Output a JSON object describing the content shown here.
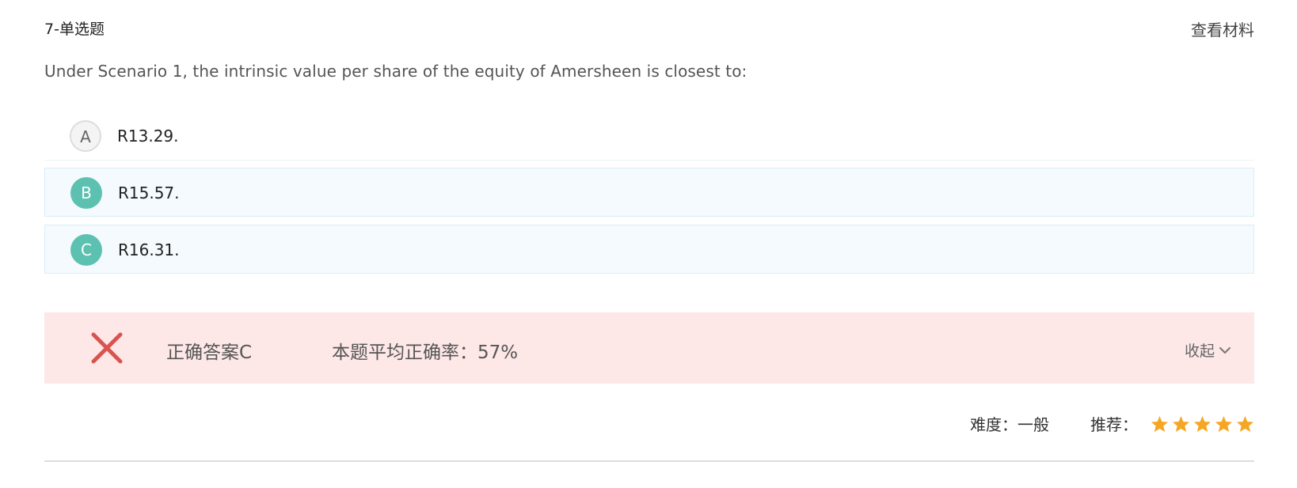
{
  "header": {
    "question_type": "7-单选题",
    "view_material": "查看材料"
  },
  "question": {
    "text": "Under Scenario 1, the intrinsic value per share of the equity of Amersheen is closest to:"
  },
  "options": [
    {
      "letter": "A",
      "text": "R13.29."
    },
    {
      "letter": "B",
      "text": "R15.57."
    },
    {
      "letter": "C",
      "text": "R16.31."
    }
  ],
  "result": {
    "status_icon": "wrong-x-icon",
    "correct_answer": "正确答案C",
    "average_rate": "本题平均正确率：57%",
    "collapse_label": "收起"
  },
  "meta": {
    "difficulty": "难度：一般",
    "recommend_label": "推荐：",
    "recommend_stars": 5
  },
  "colors": {
    "option_fill": "#5dc1b1",
    "result_bg": "#fde7e7",
    "wrong_mark": "#d9534f",
    "star": "#f5a623"
  }
}
